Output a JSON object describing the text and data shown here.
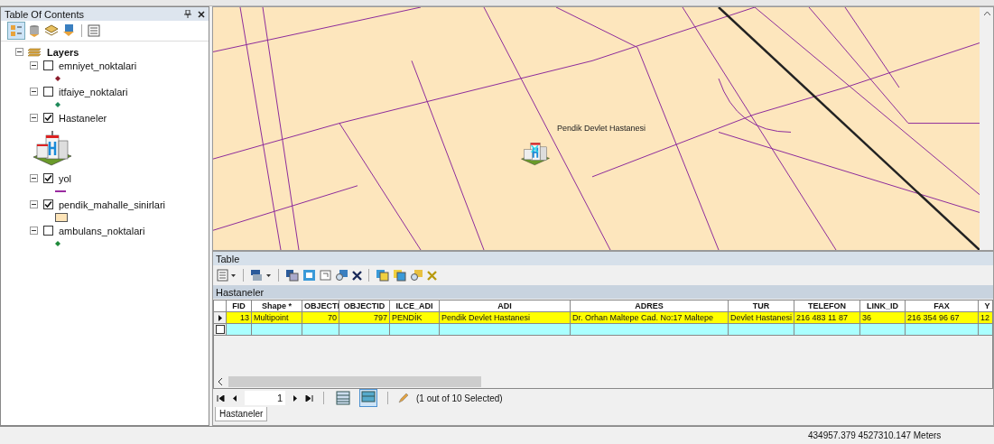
{
  "toc": {
    "title": "Table Of Contents",
    "root": {
      "label": "Layers",
      "expanded": true,
      "children": [
        {
          "label": "emniyet_noktalari",
          "checked": false,
          "expanded": true,
          "kind": "point",
          "color": "#8b1c2c"
        },
        {
          "label": "itfaiye_noktalari",
          "checked": false,
          "expanded": true,
          "kind": "point",
          "color": "#1f8a5a"
        },
        {
          "label": "Hastaneler",
          "checked": true,
          "expanded": true,
          "kind": "hospital"
        },
        {
          "label": "yol",
          "checked": true,
          "expanded": true,
          "kind": "line",
          "color": "#9a2aa0"
        },
        {
          "label": "pendik_mahalle_sinirlari",
          "checked": true,
          "expanded": true,
          "kind": "polygon",
          "color": "#fde4b8"
        },
        {
          "label": "ambulans_noktalari",
          "checked": false,
          "expanded": true,
          "kind": "point",
          "color": "#1f8a3a"
        }
      ]
    }
  },
  "map": {
    "feature_label": "Pendik Devlet Hastanesi"
  },
  "table": {
    "title": "Table",
    "layer": "Hastaneler",
    "columns": [
      {
        "label": "FID",
        "kind": "number"
      },
      {
        "label": "Shape *",
        "kind": "text"
      },
      {
        "label": "OBJECTI",
        "kind": "number"
      },
      {
        "label": "OBJECTID",
        "kind": "number"
      },
      {
        "label": "ILCE_ADI",
        "kind": "text"
      },
      {
        "label": "ADI",
        "kind": "text"
      },
      {
        "label": "ADRES",
        "kind": "text"
      },
      {
        "label": "TUR",
        "kind": "text"
      },
      {
        "label": "TELEFON",
        "kind": "text"
      },
      {
        "label": "LINK_ID",
        "kind": "text"
      },
      {
        "label": "FAX",
        "kind": "text"
      },
      {
        "label": "Y",
        "kind": "text"
      }
    ],
    "rows": [
      {
        "selected": true,
        "current": true,
        "cells": [
          "13",
          "Multipoint",
          "70",
          "797",
          "PENDİK",
          "Pendik Devlet Hastanesi",
          "Dr. Orhan Maltepe Cad. No:17 Maltepe",
          "Devlet Hastanesi",
          "216 483 11 87",
          "36",
          "216 354 96 67",
          "12"
        ]
      }
    ],
    "record": "1",
    "selection_status": "(1 out of 10 Selected)",
    "show_selected": true,
    "tabs": [
      {
        "label": "Hastaneler",
        "selected": true
      }
    ]
  },
  "status_bar": {
    "coordinates": "434957.379  4527310.147 Meters"
  }
}
